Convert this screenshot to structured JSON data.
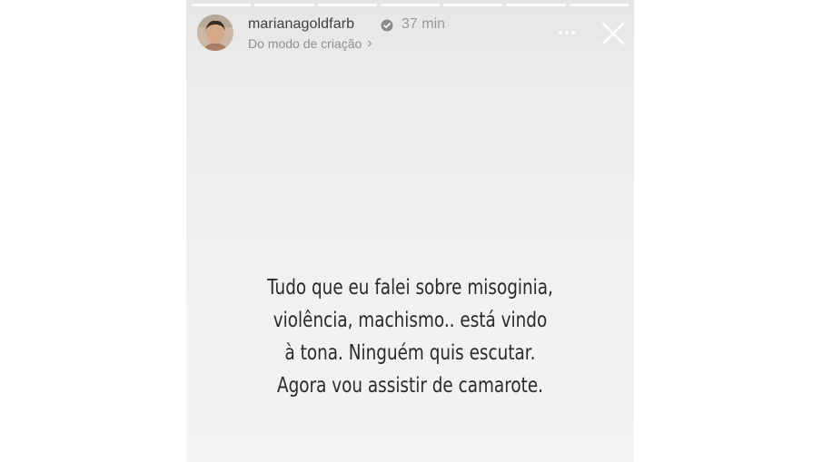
{
  "story": {
    "progress_segments": 7,
    "progress_completed": 7,
    "header": {
      "username": "marianagoldfarb",
      "verified": true,
      "verified_icon": "verified-badge-icon",
      "time": "37 min",
      "subtitle": "Do modo de criação",
      "subtitle_chevron": "›",
      "more_icon": "more-options-icon",
      "close_icon": "close-icon"
    },
    "message_lines": [
      "Tudo que eu falei sobre misoginia,",
      "violência, machismo.. está vindo",
      "à tona. Ninguém quis escutar.",
      "Agora vou assistir de camarote."
    ],
    "colors": {
      "background": "#ededed",
      "text": "#2a2a2a",
      "username": "#3e3e3e",
      "muted": "#9a9a9a"
    }
  }
}
